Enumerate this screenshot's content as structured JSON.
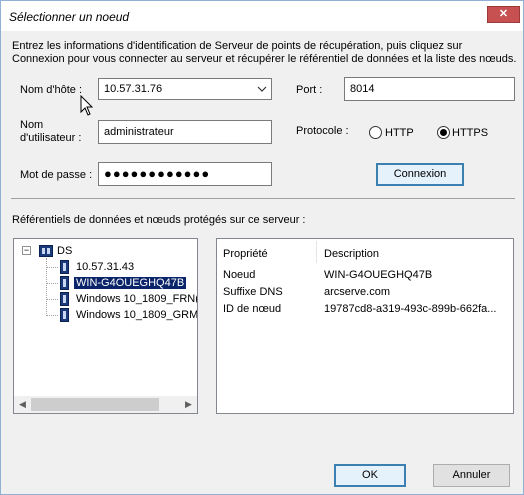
{
  "window": {
    "title": "Sélectionner un noeud",
    "close_label": "✕"
  },
  "instructions": "Entrez les informations d'identification de Serveur de points de récupération, puis cliquez sur Connexion pour vous connecter au serveur et récupérer le référentiel de données et la liste des nœuds.",
  "form": {
    "hostname_label": "Nom d'hôte :",
    "hostname_value": "10.57.31.76",
    "port_label": "Port :",
    "port_value": "8014",
    "username_label_line1": "Nom",
    "username_label_line2": "d'utilisateur :",
    "username_value": "administrateur",
    "protocol_label": "Protocole :",
    "protocol_options": [
      {
        "label": "HTTP",
        "selected": false
      },
      {
        "label": "HTTPS",
        "selected": true
      }
    ],
    "password_label": "Mot de passe :",
    "password_value": "●●●●●●●●●●●●",
    "connect_button": "Connexion"
  },
  "repositories_label": "Référentiels de données et nœuds protégés sur ce serveur :",
  "tree": {
    "root": {
      "label": "DS",
      "expander": "−"
    },
    "children": [
      {
        "label": "10.57.31.43",
        "selected": false
      },
      {
        "label": "WIN-G4OUEGHQ47B",
        "selected": true
      },
      {
        "label": "Windows 10_1809_FRN(",
        "selected": false
      },
      {
        "label": "Windows 10_1809_GRM",
        "selected": false
      }
    ],
    "scroll_left": "◀",
    "scroll_right": "▶"
  },
  "properties": {
    "headers": {
      "property": "Propriété",
      "description": "Description"
    },
    "rows": [
      {
        "key": "Noeud",
        "value": "WIN-G4OUEGHQ47B"
      },
      {
        "key": "Suffixe DNS",
        "value": "arcserve.com"
      },
      {
        "key": "ID de nœud",
        "value": "19787cd8-a319-493c-899b-662fa..."
      }
    ]
  },
  "footer": {
    "ok_button": "OK",
    "cancel_button": "Annuler"
  },
  "colors": {
    "selection": "#0a246a",
    "close_button": "#c75050",
    "default_button_border": "#3c7fb1"
  }
}
